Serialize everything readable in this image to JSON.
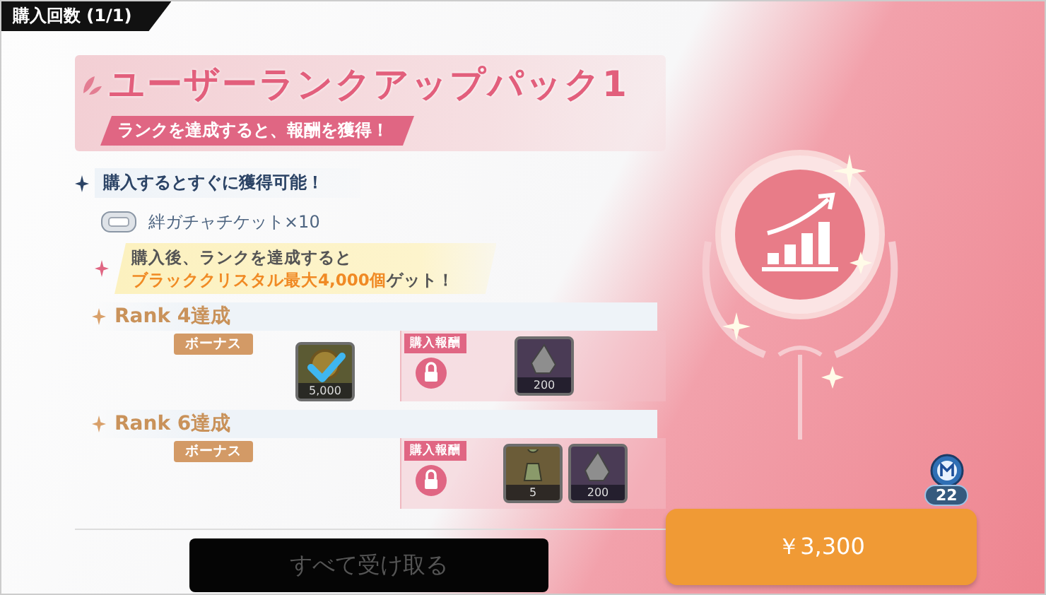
{
  "purchase_count": "購入回数 (1/1)",
  "pack": {
    "title": "ユーザーランクアップパック1",
    "subtitle": "ランクを達成すると、報酬を獲得！"
  },
  "immediate": {
    "heading": "購入するとすぐに獲得可能！",
    "item": "絆ガチャチケット×10"
  },
  "notice": {
    "line1": "購入後、ランクを達成すると",
    "highlight": "ブラッククリスタル最大4,000個",
    "tail": "ゲット！"
  },
  "ranks": [
    {
      "title": "Rank 4達成",
      "bonus_label": "ボーナス",
      "bonus_items": [
        {
          "kind": "coin",
          "count": "5,000",
          "claimed": true
        }
      ],
      "paid_label": "購入報酬",
      "locked": true,
      "paid_items": [
        {
          "kind": "crystal",
          "count": "200",
          "claimed": false
        }
      ]
    },
    {
      "title": "Rank 6達成",
      "bonus_label": "ボーナス",
      "paid_label": "購入報酬",
      "locked": true,
      "paid_items": [
        {
          "kind": "figure",
          "count": "5",
          "claimed": false
        },
        {
          "kind": "crystal",
          "count": "200",
          "claimed": false
        }
      ]
    }
  ],
  "claim_all_button": {
    "label": "すべて受け取る",
    "disabled": true
  },
  "mileage": {
    "count": "22"
  },
  "price_button": {
    "label": "￥3,300"
  }
}
